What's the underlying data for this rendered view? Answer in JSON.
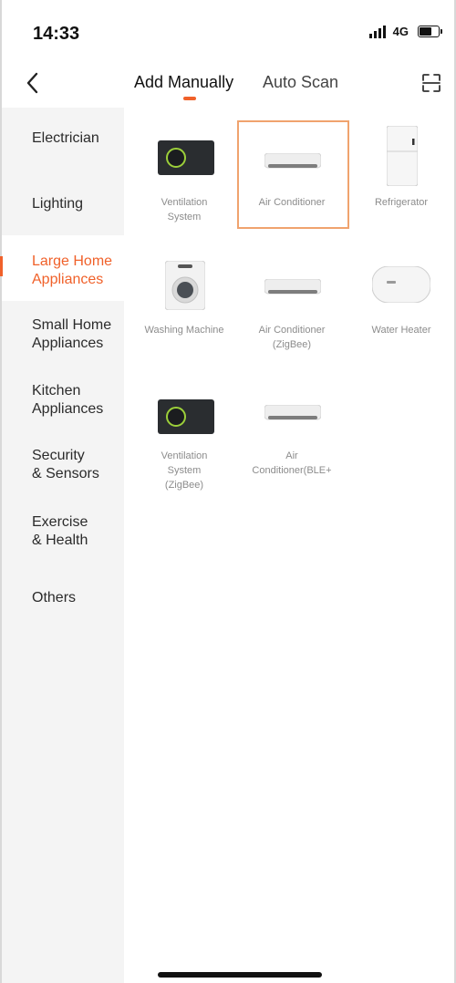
{
  "status_bar": {
    "time": "14:33",
    "network": "4G"
  },
  "nav": {
    "tabs": [
      {
        "label": "Add Manually"
      },
      {
        "label": "Auto Scan"
      }
    ]
  },
  "accent_color": "#f0612a",
  "sidebar": {
    "items": [
      {
        "label": "Electrician"
      },
      {
        "label": "Lighting"
      },
      {
        "label": "Large Home\nAppliances",
        "active": true
      },
      {
        "label": "Small Home\nAppliances"
      },
      {
        "label": "Kitchen\nAppliances"
      },
      {
        "label": "Security\n& Sensors"
      },
      {
        "label": "Exercise\n& Health"
      },
      {
        "label": "Others"
      }
    ]
  },
  "devices": [
    {
      "label": "Ventilation\nSystem",
      "icon": "ventilation-icon"
    },
    {
      "label": "Air Conditioner",
      "icon": "air-conditioner-icon",
      "selected": true
    },
    {
      "label": "Refrigerator",
      "icon": "refrigerator-icon"
    },
    {
      "label": "Washing Machine",
      "icon": "washing-machine-icon"
    },
    {
      "label": "Air Conditioner\n(ZigBee)",
      "icon": "air-conditioner-icon"
    },
    {
      "label": "Water Heater",
      "icon": "water-heater-icon"
    },
    {
      "label": "Ventilation\nSystem\n(ZigBee)",
      "icon": "ventilation-icon"
    },
    {
      "label": "Air\nConditioner(BLE+",
      "icon": "air-conditioner-icon"
    }
  ]
}
